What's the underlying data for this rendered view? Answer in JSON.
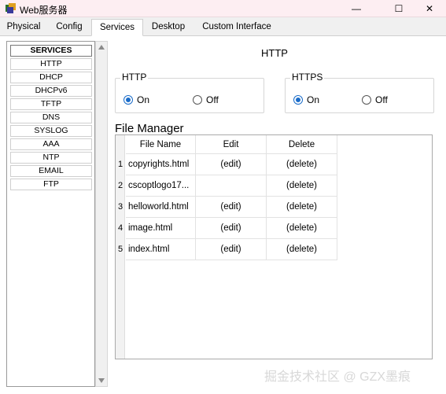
{
  "window": {
    "title": "Web服务器",
    "controls": {
      "minimize": "—",
      "maximize": "☐",
      "close": "✕"
    }
  },
  "tabs": [
    {
      "label": "Physical",
      "active": false
    },
    {
      "label": "Config",
      "active": false
    },
    {
      "label": "Services",
      "active": true
    },
    {
      "label": "Desktop",
      "active": false
    },
    {
      "label": "Custom Interface",
      "active": false
    }
  ],
  "sidebar": {
    "header": "SERVICES",
    "items": [
      "HTTP",
      "DHCP",
      "DHCPv6",
      "TFTP",
      "DNS",
      "SYSLOG",
      "AAA",
      "NTP",
      "EMAIL",
      "FTP"
    ]
  },
  "main": {
    "title": "HTTP",
    "http_group": {
      "label": "HTTP",
      "on_label": "On",
      "off_label": "Off",
      "selected": "On"
    },
    "https_group": {
      "label": "HTTPS",
      "on_label": "On",
      "off_label": "Off",
      "selected": "On"
    },
    "file_manager": {
      "title": "File Manager",
      "columns": [
        "File Name",
        "Edit",
        "Delete"
      ],
      "rows": [
        {
          "num": "1",
          "name": "copyrights.html",
          "edit": "(edit)",
          "delete": "(delete)"
        },
        {
          "num": "2",
          "name": "cscoptlogo17...",
          "edit": "",
          "delete": "(delete)"
        },
        {
          "num": "3",
          "name": "helloworld.html",
          "edit": "(edit)",
          "delete": "(delete)"
        },
        {
          "num": "4",
          "name": "image.html",
          "edit": "(edit)",
          "delete": "(delete)"
        },
        {
          "num": "5",
          "name": "index.html",
          "edit": "(edit)",
          "delete": "(delete)"
        }
      ]
    }
  },
  "watermark": "掘金技术社区 @ GZX墨痕",
  "colors": {
    "accent": "#1a6cc9",
    "titlebar": "#fdeef2"
  }
}
